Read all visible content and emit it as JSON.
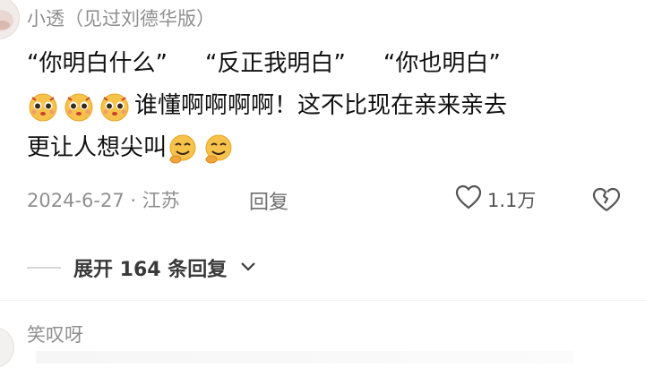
{
  "comment": {
    "username": "小透（见过刘德华版）",
    "line1": [
      "“你明白什么”",
      "“反正我明白”",
      "“你也明白”"
    ],
    "line2_emojis": [
      "pleading-face-icon",
      "pleading-face-icon",
      "pleading-face-icon"
    ],
    "line2_text": "谁懂啊啊啊啊！这不比现在亲来亲去",
    "line3_text": "更让人想尖叫",
    "line3_emojis": [
      "thinking-grin-icon",
      "thinking-grin-icon"
    ],
    "date_location": "2024-6-27 · 江苏",
    "reply_label": "回复",
    "like_count": "1.1万",
    "expand_label": "展开 164 条回复"
  },
  "next_comment": {
    "username": "笑叹呀"
  },
  "colors": {
    "text": "#111111",
    "meta": "#8f8f8f",
    "emoji_face": "#f7c24a"
  }
}
